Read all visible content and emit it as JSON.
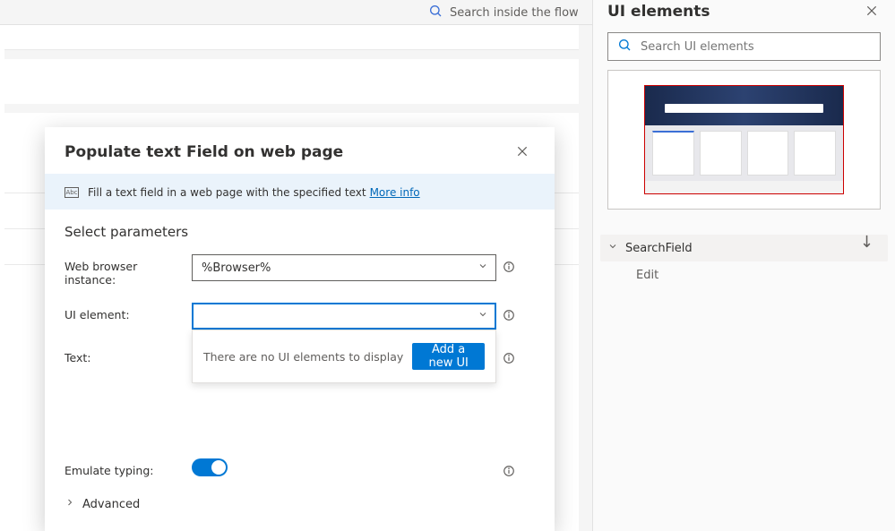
{
  "bg_search_placeholder": "Search inside the flow",
  "right_panel": {
    "title": "UI elements",
    "search_placeholder": "Search UI elements",
    "arrow_down": "↓",
    "tree": {
      "parent_label": "SearchField",
      "child_label": "Edit"
    }
  },
  "modal": {
    "title": "Populate text Field on web page",
    "info_desc": "Fill a text field in a web page with the specified text",
    "more_info": "More info",
    "section_title": "Select parameters",
    "labels": {
      "browser": "Web browser instance:",
      "ui_element": "UI element:",
      "text": "Text:",
      "emulate": "Emulate typing:",
      "advanced": "Advanced"
    },
    "browser_value": "%Browser%",
    "ui_element_value": "",
    "empty_msg": "There are no UI elements to display",
    "add_btn": "Add a new UI element",
    "text_value": "",
    "emulate_on": true
  }
}
